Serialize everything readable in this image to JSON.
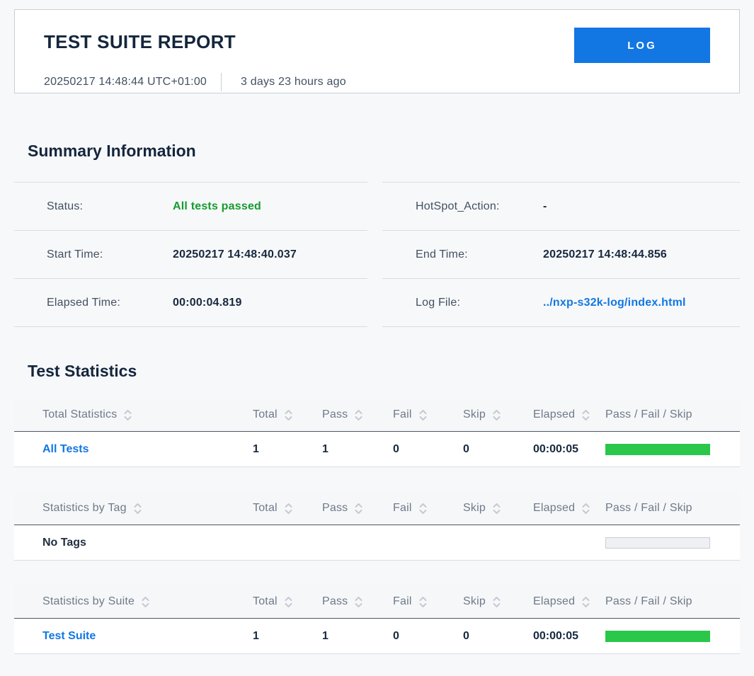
{
  "header_card": {
    "title": "TEST SUITE REPORT",
    "timestamp": "20250217 14:48:44 UTC+01:00",
    "relative_time": "3 days 23 hours ago",
    "log_button_label": "LOG"
  },
  "summary": {
    "heading": "Summary Information",
    "left_rows": [
      {
        "label": "Status:",
        "value": "All tests passed"
      },
      {
        "label": "Start Time:",
        "value": "20250217 14:48:40.037"
      },
      {
        "label": "Elapsed Time:",
        "value": "00:00:04.819"
      }
    ],
    "right_rows": [
      {
        "label": "HotSpot_Action:",
        "value": "-"
      },
      {
        "label": "End Time:",
        "value": "20250217 14:48:44.856"
      },
      {
        "label": "Log File:",
        "value": "../nxp-s32k-log/index.html"
      }
    ]
  },
  "statistics": {
    "heading": "Test Statistics",
    "columns": [
      "Total",
      "Pass",
      "Fail",
      "Skip",
      "Elapsed",
      "Pass / Fail / Skip"
    ],
    "tables": [
      {
        "first_col": "Total Statistics",
        "rows": [
          {
            "name": "All Tests",
            "total": "1",
            "pass": "1",
            "fail": "0",
            "skip": "0",
            "elapsed": "00:00:05",
            "bar": "pass"
          }
        ]
      },
      {
        "first_col": "Statistics by Tag",
        "rows": [
          {
            "name": "No Tags",
            "total": "",
            "pass": "",
            "fail": "",
            "skip": "",
            "elapsed": "",
            "bar": "empty"
          }
        ]
      },
      {
        "first_col": "Statistics by Suite",
        "rows": [
          {
            "name": "Test Suite",
            "total": "1",
            "pass": "1",
            "fail": "0",
            "skip": "0",
            "elapsed": "00:00:05",
            "bar": "pass"
          }
        ]
      }
    ]
  },
  "icons": {
    "sort_icon": "dual chevron up/down"
  },
  "colors": {
    "accent_blue": "#1277e2",
    "pass_text_green": "#169b2f",
    "pass_bar_green": "#2bc74a",
    "page_background": "#f7f8fa",
    "dark_navy_text": "#14263c"
  }
}
